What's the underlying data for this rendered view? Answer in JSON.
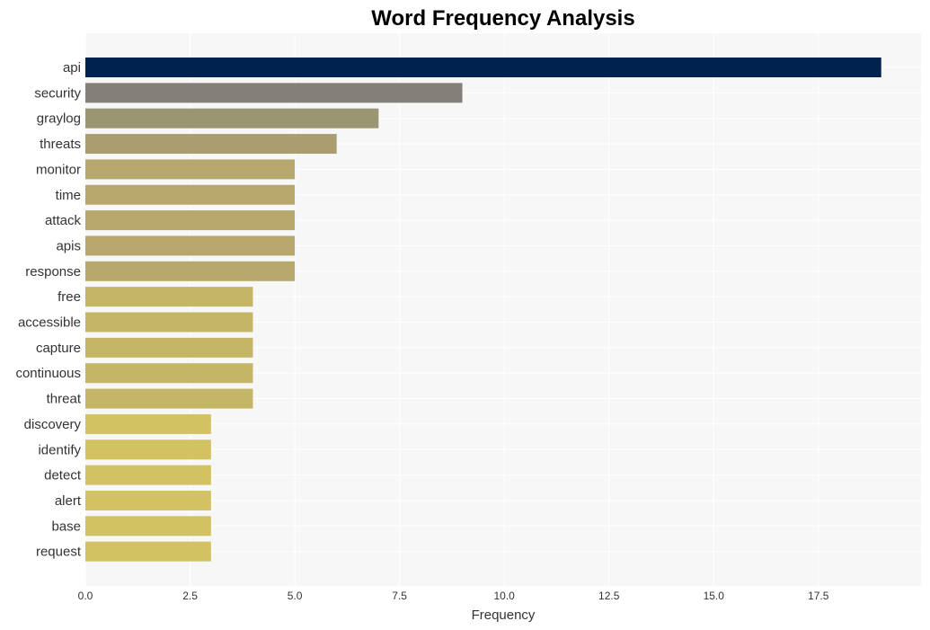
{
  "chart_data": {
    "type": "bar",
    "orientation": "horizontal",
    "title": "Word Frequency Analysis",
    "xlabel": "Frequency",
    "ylabel": "",
    "xlim": [
      0,
      19.95
    ],
    "xticks": [
      0.0,
      2.5,
      5.0,
      7.5,
      10.0,
      12.5,
      15.0,
      17.5
    ],
    "xtick_labels": [
      "0.0",
      "2.5",
      "5.0",
      "7.5",
      "10.0",
      "12.5",
      "15.0",
      "17.5"
    ],
    "grid": true,
    "categories": [
      "api",
      "security",
      "graylog",
      "threats",
      "monitor",
      "time",
      "attack",
      "apis",
      "response",
      "free",
      "accessible",
      "capture",
      "continuous",
      "threat",
      "discovery",
      "identify",
      "detect",
      "alert",
      "base",
      "request"
    ],
    "values": [
      19,
      9,
      7,
      6,
      5,
      5,
      5,
      5,
      5,
      4,
      4,
      4,
      4,
      4,
      3,
      3,
      3,
      3,
      3,
      3
    ],
    "colors": [
      "#00224e",
      "#838079",
      "#9c9572",
      "#aa9e70",
      "#b6a86c",
      "#b6a86c",
      "#b6a86c",
      "#b6a86c",
      "#b6a86c",
      "#c5b567",
      "#c5b567",
      "#c5b567",
      "#c5b567",
      "#c5b567",
      "#d3c262",
      "#d3c262",
      "#d3c262",
      "#d3c262",
      "#d3c262",
      "#d3c262"
    ],
    "background": "#f7f7f7",
    "grid_color": "#ffffff"
  }
}
